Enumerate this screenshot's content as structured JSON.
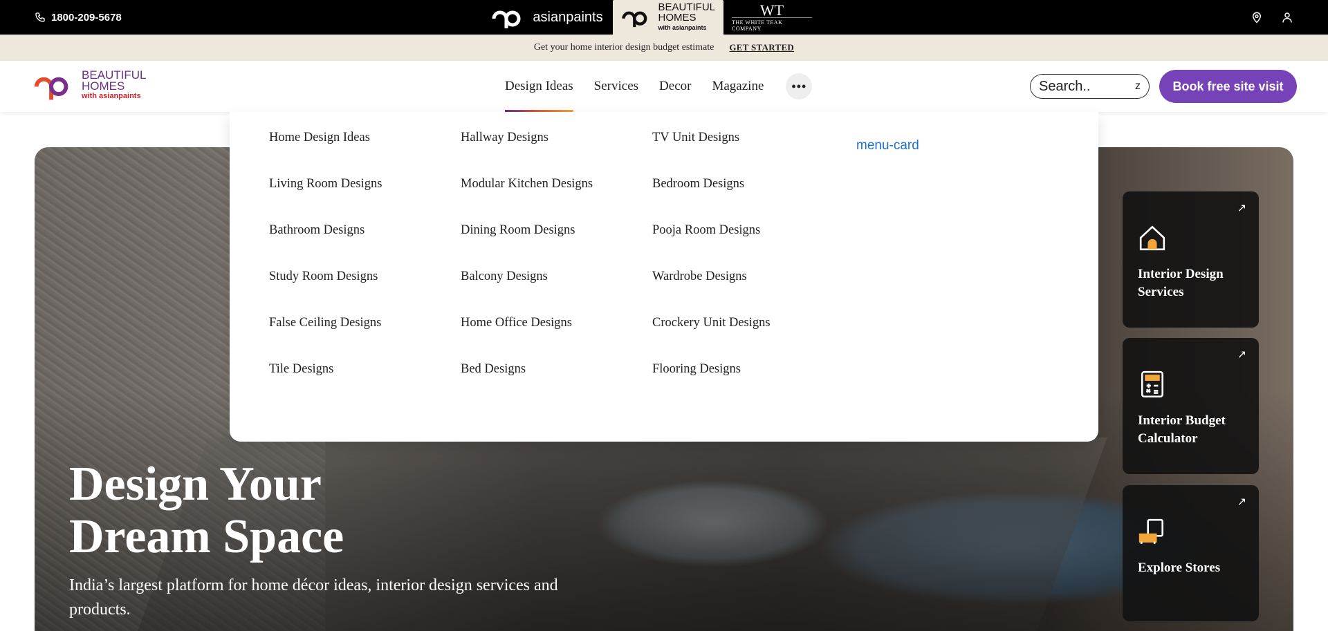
{
  "topbar": {
    "phone": "1800-209-5678",
    "brands": {
      "asianpaints": "asianpaints",
      "beautiful_homes_line1": "BEAUTIFUL",
      "beautiful_homes_line2": "HOMES",
      "beautiful_homes_sub": "with asianpaints",
      "white_teak_logo": "WT",
      "white_teak_name": "THE WHITE TEAK COMPANY"
    },
    "icons": [
      "location-icon",
      "user-icon"
    ]
  },
  "promo": {
    "text": "Get your home interior design budget estimate",
    "cta": "GET STARTED"
  },
  "nav": {
    "logo_line1": "BEAUTIFUL",
    "logo_line2": "HOMES",
    "logo_sub": "with asianpaints",
    "links": [
      "Design Ideas",
      "Services",
      "Decor",
      "Magazine"
    ],
    "more_label": "•••",
    "search_placeholder": "Search..",
    "search_key": "z",
    "book_button": "Book free site visit"
  },
  "dropdown": {
    "tag": "menu-card",
    "columns": [
      [
        "Home Design Ideas",
        "Living Room Designs",
        "Bathroom Designs",
        "Study Room Designs",
        "False Ceiling Designs",
        "Tile Designs"
      ],
      [
        "Hallway Designs",
        "Modular Kitchen Designs",
        "Dining Room Designs",
        "Balcony Designs",
        "Home Office Designs",
        "Bed Designs"
      ],
      [
        "TV Unit Designs",
        "Bedroom Designs",
        "Pooja Room Designs",
        "Wardrobe Designs",
        "Crockery Unit Designs",
        "Flooring Designs"
      ]
    ]
  },
  "hero": {
    "title_line1": "Design Your",
    "title_line2": "Dream Space",
    "subtitle": "India’s largest platform for home décor ideas, interior design services and products."
  },
  "side_cards": [
    {
      "label_line1": "Interior Design",
      "label_line2": "Services",
      "icon": "house-icon"
    },
    {
      "label_line1": "Interior Budget",
      "label_line2": "Calculator",
      "icon": "calculator-icon"
    },
    {
      "label_line1": "Explore Stores",
      "label_line2": "",
      "icon": "sofa-store-icon"
    }
  ],
  "colors": {
    "accent_purple": "#7642b8",
    "promo_bg": "#eee7dc",
    "link_blue": "#1a6fd1"
  }
}
